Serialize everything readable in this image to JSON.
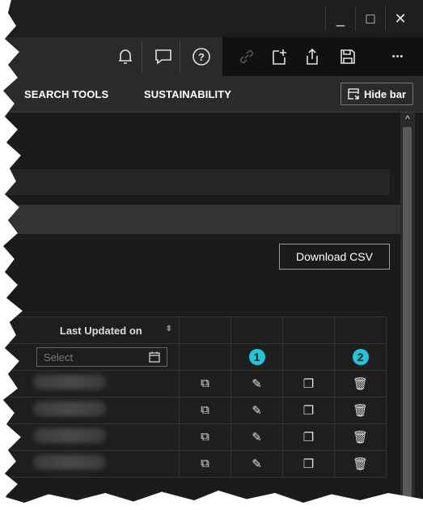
{
  "window": {
    "minimize": "_",
    "maximize": "□",
    "close": "✕"
  },
  "toolbar": {
    "more": "•••"
  },
  "nav": {
    "items": [
      "SEARCH TOOLS",
      "SUSTAINABILITY"
    ],
    "hide_bar": "Hide bar"
  },
  "actions": {
    "download_csv": "Download CSV"
  },
  "table": {
    "column_header": "Last Updated on",
    "date_placeholder": "Select",
    "badges": [
      "1",
      "2"
    ],
    "row_count": 4
  },
  "colors": {
    "badge": "#1ec8d8",
    "background": "#1b1b1b"
  }
}
